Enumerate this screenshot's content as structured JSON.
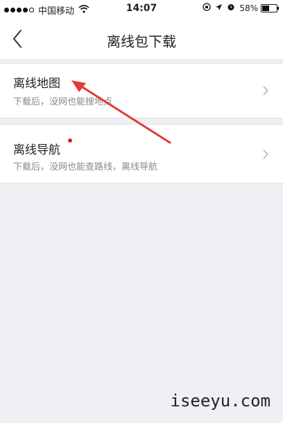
{
  "status": {
    "carrier": "中国移动",
    "time": "14:07",
    "battery": "58%",
    "battery_level": 0.58
  },
  "nav": {
    "title": "离线包下载",
    "back_icon": "chevron-left-icon"
  },
  "items": [
    {
      "title": "离线地图",
      "desc": "下载后，没网也能搜地点"
    },
    {
      "title": "离线导航",
      "desc": "下载后，没网也能查路线，离线导航",
      "badge": "red-dot"
    }
  ],
  "watermark": "iseeyu.com",
  "colors": {
    "background": "#efeff4",
    "annotation_arrow": "#e53935",
    "badge_dot": "#e02020"
  }
}
